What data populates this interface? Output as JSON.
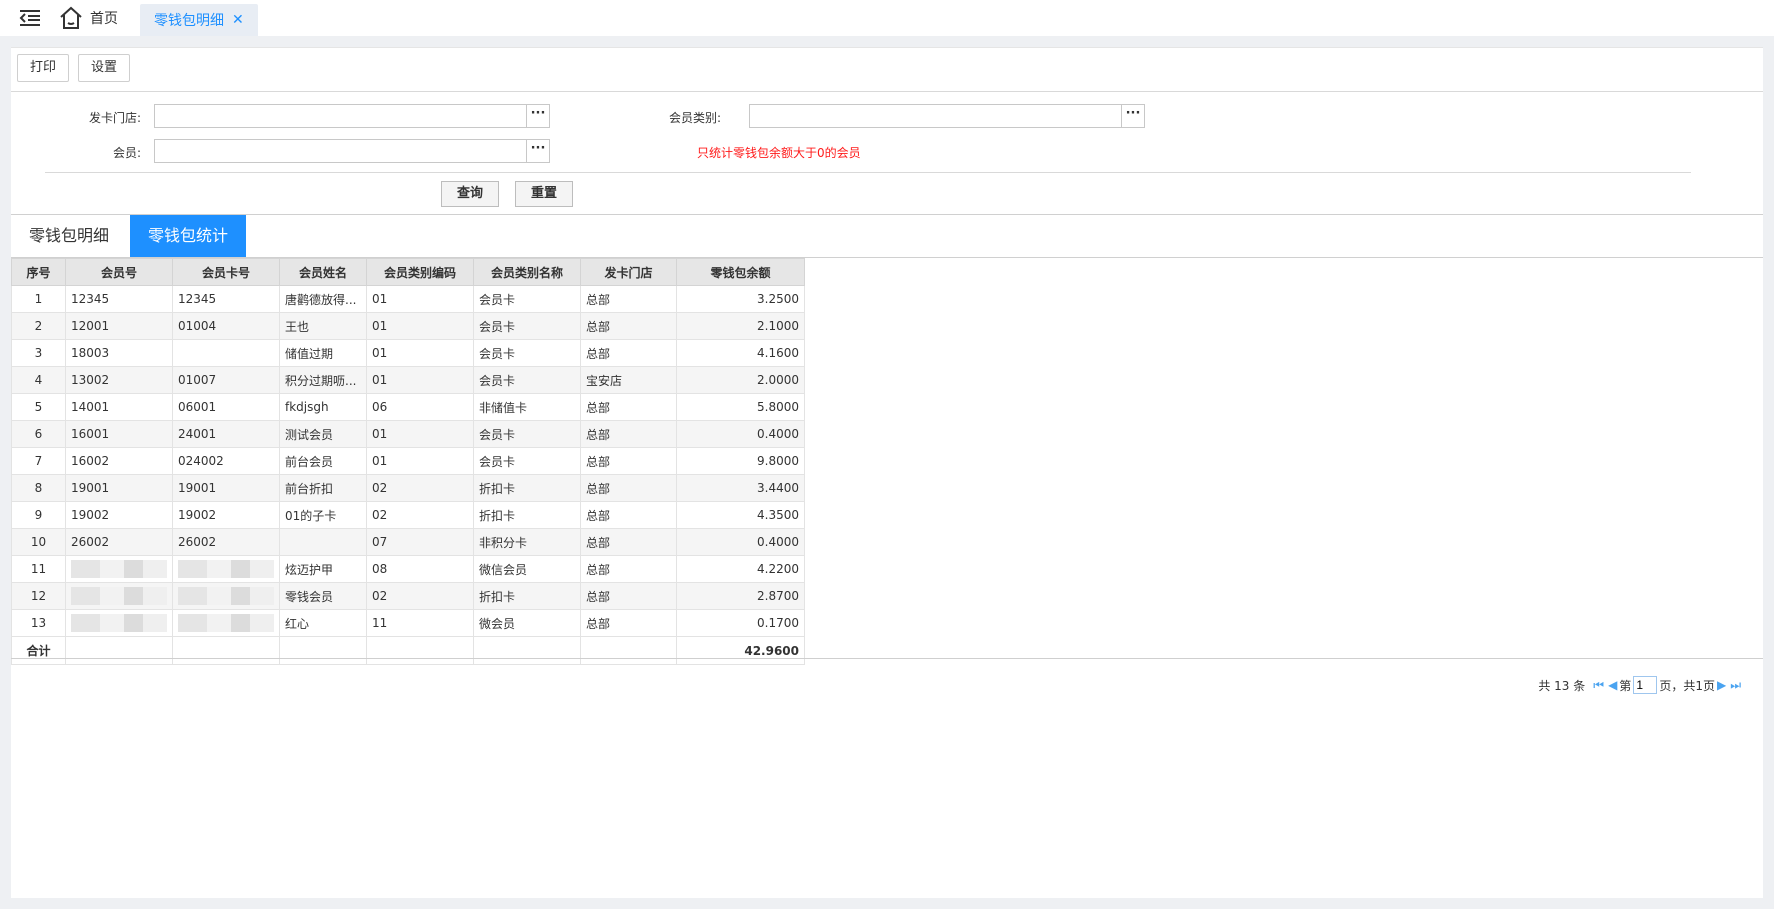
{
  "topbar": {
    "home_label": "首页",
    "active_tab_label": "零钱包明细",
    "close_glyph": "✕"
  },
  "toolbar": {
    "print_label": "打印",
    "settings_label": "设置"
  },
  "filters": {
    "store_label": "发卡门店:",
    "member_type_label": "会员类别:",
    "member_label": "会员:",
    "store_value": "",
    "member_type_value": "",
    "member_value": "",
    "lookup_glyph": "···",
    "note": "只统计零钱包余额大于0的会员",
    "query_label": "查询",
    "reset_label": "重置"
  },
  "tabs": {
    "detail": "零钱包明细",
    "stats": "零钱包统计"
  },
  "grid": {
    "headers": [
      "序号",
      "会员号",
      "会员卡号",
      "会员姓名",
      "会员类别编码",
      "会员类别名称",
      "发卡门店",
      "零钱包余额"
    ],
    "rows": [
      [
        "1",
        "12345",
        "12345",
        "唐鹳德放得...",
        "01",
        "会员卡",
        "总部",
        "3.2500"
      ],
      [
        "2",
        "12001",
        "01004",
        "王也",
        "01",
        "会员卡",
        "总部",
        "2.1000"
      ],
      [
        "3",
        "18003",
        "",
        "储值过期",
        "01",
        "会员卡",
        "总部",
        "4.1600"
      ],
      [
        "4",
        "13002",
        "01007",
        "积分过期呖...",
        "01",
        "会员卡",
        "宝安店",
        "2.0000"
      ],
      [
        "5",
        "14001",
        "06001",
        "fkdjsgh",
        "06",
        "非储值卡",
        "总部",
        "5.8000"
      ],
      [
        "6",
        "16001",
        "24001",
        "测试会员",
        "01",
        "会员卡",
        "总部",
        "0.4000"
      ],
      [
        "7",
        "16002",
        "024002",
        "前台会员",
        "01",
        "会员卡",
        "总部",
        "9.8000"
      ],
      [
        "8",
        "19001",
        "19001",
        "前台折扣",
        "02",
        "折扣卡",
        "总部",
        "3.4400"
      ],
      [
        "9",
        "19002",
        "19002",
        "01的子卡",
        "02",
        "折扣卡",
        "总部",
        "4.3500"
      ],
      [
        "10",
        "26002",
        "26002",
        "",
        "07",
        "非积分卡",
        "总部",
        "0.4000"
      ],
      [
        "11",
        "",
        "",
        "炫迈护甲",
        "08",
        "微信会员",
        "总部",
        "4.2200"
      ],
      [
        "12",
        "",
        "",
        "零钱会员",
        "02",
        "折扣卡",
        "总部",
        "2.8700"
      ],
      [
        "13",
        "",
        "",
        "红心",
        "11",
        "微会员",
        "总部",
        "0.1700"
      ]
    ],
    "total_label": "合计",
    "total_value": "42.9600"
  },
  "pager": {
    "total_text": "共 13 条",
    "page_prefix": "第",
    "page_value": "1",
    "page_suffix": "页，共1页",
    "first_icon": "first-page-icon",
    "prev_icon": "prev-page-icon",
    "next_icon": "next-page-icon",
    "last_icon": "last-page-icon"
  },
  "colors": {
    "accent": "#1e90ff",
    "note": "#ff1a1a",
    "header_bg": "#e6e6e6"
  }
}
